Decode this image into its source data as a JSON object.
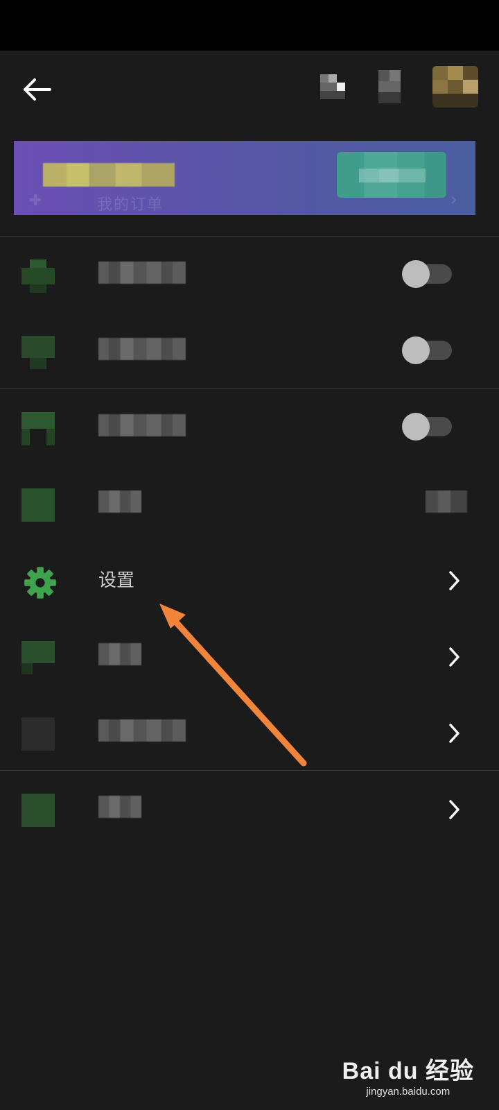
{
  "header": {
    "back_icon": "arrow-left-icon"
  },
  "banner": {
    "subtitle": "我的订单"
  },
  "menu": {
    "settings_label": "设置",
    "settings_icon": "gear-icon"
  },
  "watermark": {
    "logo": "Bai du 经验",
    "url": "jingyan.baidu.com"
  },
  "colors": {
    "background": "#1b1b1b",
    "accent_green": "#3fa34d",
    "arrow": "#f2853a",
    "banner_start": "#6a4fb4",
    "banner_end": "#4a5fa0"
  }
}
